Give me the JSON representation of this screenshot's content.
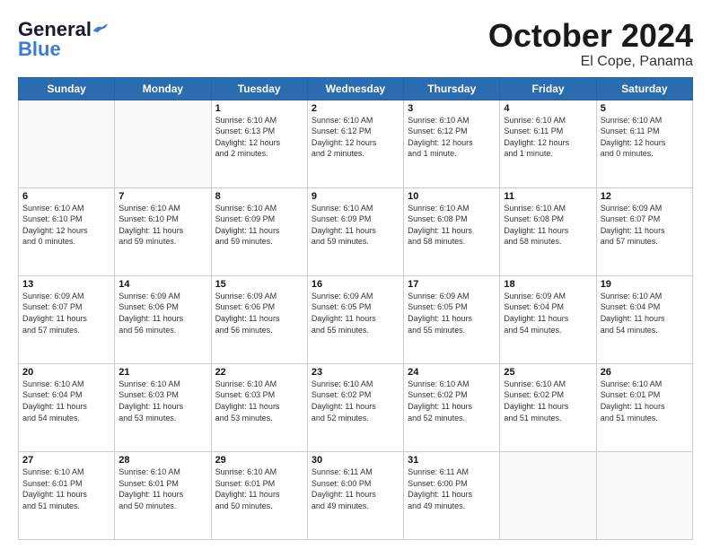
{
  "header": {
    "logo": {
      "line1": "General",
      "line2": "Blue"
    },
    "title": "October 2024",
    "location": "El Cope, Panama"
  },
  "weekdays": [
    "Sunday",
    "Monday",
    "Tuesday",
    "Wednesday",
    "Thursday",
    "Friday",
    "Saturday"
  ],
  "weeks": [
    [
      {
        "day": "",
        "info": ""
      },
      {
        "day": "",
        "info": ""
      },
      {
        "day": "1",
        "info": "Sunrise: 6:10 AM\nSunset: 6:13 PM\nDaylight: 12 hours\nand 2 minutes."
      },
      {
        "day": "2",
        "info": "Sunrise: 6:10 AM\nSunset: 6:12 PM\nDaylight: 12 hours\nand 2 minutes."
      },
      {
        "day": "3",
        "info": "Sunrise: 6:10 AM\nSunset: 6:12 PM\nDaylight: 12 hours\nand 1 minute."
      },
      {
        "day": "4",
        "info": "Sunrise: 6:10 AM\nSunset: 6:11 PM\nDaylight: 12 hours\nand 1 minute."
      },
      {
        "day": "5",
        "info": "Sunrise: 6:10 AM\nSunset: 6:11 PM\nDaylight: 12 hours\nand 0 minutes."
      }
    ],
    [
      {
        "day": "6",
        "info": "Sunrise: 6:10 AM\nSunset: 6:10 PM\nDaylight: 12 hours\nand 0 minutes."
      },
      {
        "day": "7",
        "info": "Sunrise: 6:10 AM\nSunset: 6:10 PM\nDaylight: 11 hours\nand 59 minutes."
      },
      {
        "day": "8",
        "info": "Sunrise: 6:10 AM\nSunset: 6:09 PM\nDaylight: 11 hours\nand 59 minutes."
      },
      {
        "day": "9",
        "info": "Sunrise: 6:10 AM\nSunset: 6:09 PM\nDaylight: 11 hours\nand 59 minutes."
      },
      {
        "day": "10",
        "info": "Sunrise: 6:10 AM\nSunset: 6:08 PM\nDaylight: 11 hours\nand 58 minutes."
      },
      {
        "day": "11",
        "info": "Sunrise: 6:10 AM\nSunset: 6:08 PM\nDaylight: 11 hours\nand 58 minutes."
      },
      {
        "day": "12",
        "info": "Sunrise: 6:09 AM\nSunset: 6:07 PM\nDaylight: 11 hours\nand 57 minutes."
      }
    ],
    [
      {
        "day": "13",
        "info": "Sunrise: 6:09 AM\nSunset: 6:07 PM\nDaylight: 11 hours\nand 57 minutes."
      },
      {
        "day": "14",
        "info": "Sunrise: 6:09 AM\nSunset: 6:06 PM\nDaylight: 11 hours\nand 56 minutes."
      },
      {
        "day": "15",
        "info": "Sunrise: 6:09 AM\nSunset: 6:06 PM\nDaylight: 11 hours\nand 56 minutes."
      },
      {
        "day": "16",
        "info": "Sunrise: 6:09 AM\nSunset: 6:05 PM\nDaylight: 11 hours\nand 55 minutes."
      },
      {
        "day": "17",
        "info": "Sunrise: 6:09 AM\nSunset: 6:05 PM\nDaylight: 11 hours\nand 55 minutes."
      },
      {
        "day": "18",
        "info": "Sunrise: 6:09 AM\nSunset: 6:04 PM\nDaylight: 11 hours\nand 54 minutes."
      },
      {
        "day": "19",
        "info": "Sunrise: 6:10 AM\nSunset: 6:04 PM\nDaylight: 11 hours\nand 54 minutes."
      }
    ],
    [
      {
        "day": "20",
        "info": "Sunrise: 6:10 AM\nSunset: 6:04 PM\nDaylight: 11 hours\nand 54 minutes."
      },
      {
        "day": "21",
        "info": "Sunrise: 6:10 AM\nSunset: 6:03 PM\nDaylight: 11 hours\nand 53 minutes."
      },
      {
        "day": "22",
        "info": "Sunrise: 6:10 AM\nSunset: 6:03 PM\nDaylight: 11 hours\nand 53 minutes."
      },
      {
        "day": "23",
        "info": "Sunrise: 6:10 AM\nSunset: 6:02 PM\nDaylight: 11 hours\nand 52 minutes."
      },
      {
        "day": "24",
        "info": "Sunrise: 6:10 AM\nSunset: 6:02 PM\nDaylight: 11 hours\nand 52 minutes."
      },
      {
        "day": "25",
        "info": "Sunrise: 6:10 AM\nSunset: 6:02 PM\nDaylight: 11 hours\nand 51 minutes."
      },
      {
        "day": "26",
        "info": "Sunrise: 6:10 AM\nSunset: 6:01 PM\nDaylight: 11 hours\nand 51 minutes."
      }
    ],
    [
      {
        "day": "27",
        "info": "Sunrise: 6:10 AM\nSunset: 6:01 PM\nDaylight: 11 hours\nand 51 minutes."
      },
      {
        "day": "28",
        "info": "Sunrise: 6:10 AM\nSunset: 6:01 PM\nDaylight: 11 hours\nand 50 minutes."
      },
      {
        "day": "29",
        "info": "Sunrise: 6:10 AM\nSunset: 6:01 PM\nDaylight: 11 hours\nand 50 minutes."
      },
      {
        "day": "30",
        "info": "Sunrise: 6:11 AM\nSunset: 6:00 PM\nDaylight: 11 hours\nand 49 minutes."
      },
      {
        "day": "31",
        "info": "Sunrise: 6:11 AM\nSunset: 6:00 PM\nDaylight: 11 hours\nand 49 minutes."
      },
      {
        "day": "",
        "info": ""
      },
      {
        "day": "",
        "info": ""
      }
    ]
  ]
}
